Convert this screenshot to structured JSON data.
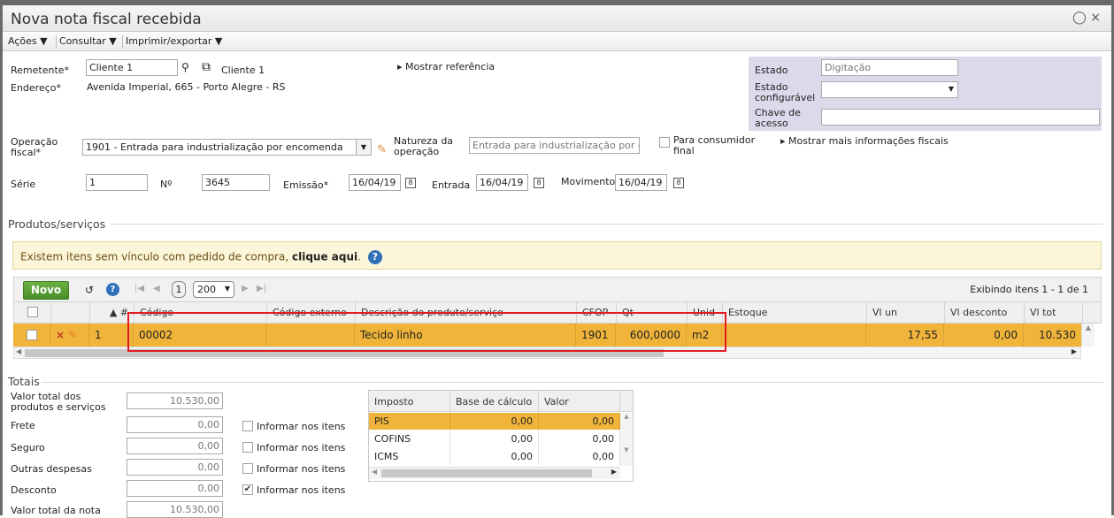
{
  "window": {
    "title": "Nova nota fiscal recebida",
    "icons": "⨏ ×"
  },
  "menu": {
    "acoes": "Ações ▼",
    "consultar": "Consultar ▼",
    "imprimir": "Imprimir/exportar ▼"
  },
  "header": {
    "remetente_label": "Remetente*",
    "remetente_value": "Cliente 1",
    "remetente_link": "Cliente 1",
    "endereco_label": "Endereço*",
    "endereco_value": "Avenida Imperial, 665 - Porto Alegre - RS",
    "mostrar_referencia": "▸ Mostrar referência",
    "estado_label": "Estado",
    "estado_value": "Digitação",
    "estado_config_label": "Estado configurável",
    "chave_label": "Chave de acesso",
    "operacao_label": "Operação fiscal*",
    "operacao_value": "1901 - Entrada para industrialização por encomenda",
    "natureza_label": "Natureza da operação",
    "natureza_value": "Entrada para industrialização por er",
    "consumidor_label": "Para consumidor final",
    "mostrar_mais": "▸ Mostrar mais informações fiscais",
    "serie_label": "Série",
    "serie_value": "1",
    "no_label": "Nº",
    "no_value": "3645",
    "emissao_label": "Emissão*",
    "emissao_value": "16/04/19",
    "entrada_label": "Entrada",
    "entrada_value": "16/04/19",
    "movimento_label": "Movimento",
    "movimento_value": "16/04/19"
  },
  "produtos": {
    "section_title": "Produtos/serviços",
    "warning_text": "Existem itens sem vínculo com pedido de compra, ",
    "warning_link": "clique aqui",
    "warning_after": ".",
    "novo": "Novo",
    "page": "1",
    "page_size": "200",
    "exibindo": "Exibindo itens 1 - 1 de 1",
    "columns": [
      "#",
      "Código",
      "Código externo",
      "Descrição do produto/serviço",
      "CFOP",
      "Qt",
      "Unid",
      "Estoque",
      "Vl un",
      "Vl desconto",
      "Vl tot"
    ],
    "row": {
      "num": "1",
      "codigo": "00002",
      "codigo_externo": "",
      "descricao": "Tecido linho",
      "cfop": "1901",
      "qt": "600,0000",
      "unid": "m2",
      "estoque": "",
      "vl_un": "17,55",
      "vl_desconto": "0,00",
      "vl_tot": "10.530"
    }
  },
  "totais": {
    "section_title": "Totais",
    "valor_produtos_label": "Valor total dos produtos e serviços",
    "valor_produtos": "10.530,00",
    "frete_label": "Frete",
    "frete": "0,00",
    "seguro_label": "Seguro",
    "seguro": "0,00",
    "outras_label": "Outras despesas",
    "outras": "0,00",
    "desconto_label": "Desconto",
    "desconto": "0,00",
    "valor_nota_label": "Valor total da nota",
    "valor_nota": "10.530,00",
    "informar": "Informar nos itens"
  },
  "impostos": {
    "columns": [
      "Imposto",
      "Base de cálculo",
      "Valor"
    ],
    "rows": [
      {
        "imposto": "PIS",
        "base": "0,00",
        "valor": "0,00"
      },
      {
        "imposto": "COFINS",
        "base": "0,00",
        "valor": "0,00"
      },
      {
        "imposto": "ICMS",
        "base": "0,00",
        "valor": "0,00"
      }
    ]
  },
  "colors": {
    "selected_row": "#f0b43a",
    "panel": "#dcdaea",
    "warn_bg": "#fbf6d9",
    "highlight": "#e31b23"
  }
}
